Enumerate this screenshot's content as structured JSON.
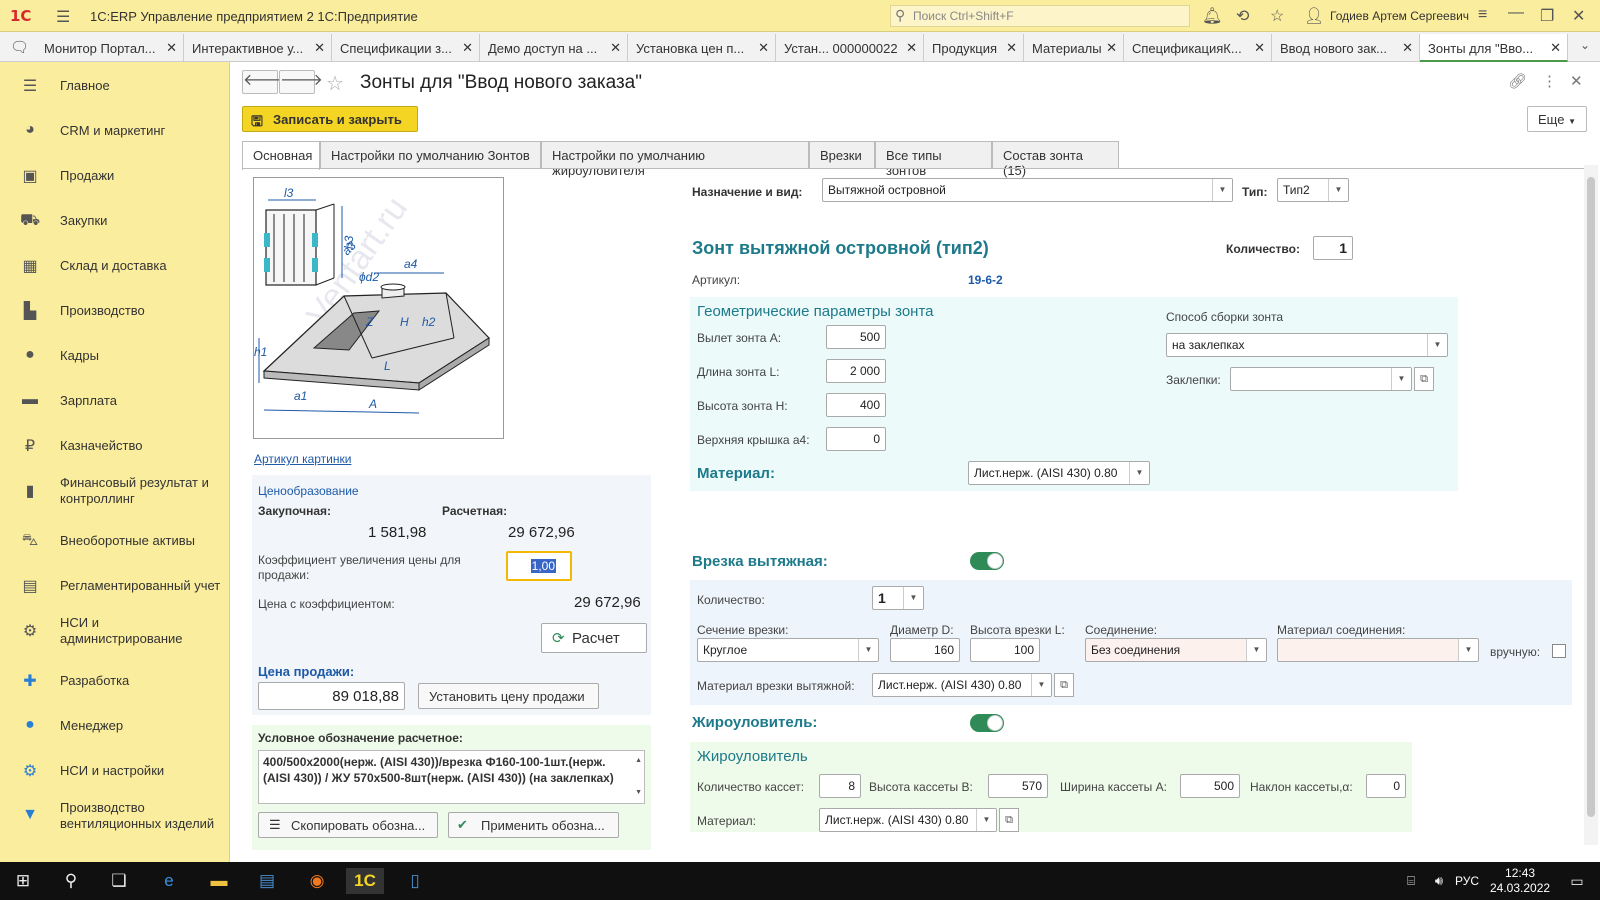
{
  "app": {
    "logo": "1С",
    "title": "1С:ERP Управление предприятием 2 1С:Предприятие",
    "search_placeholder": "Поиск Ctrl+Shift+F",
    "user": "Годиев Артем Сергеевич"
  },
  "window_tabs": [
    {
      "label": "Монитор Портал..."
    },
    {
      "label": "Интерактивное у..."
    },
    {
      "label": "Спецификации з..."
    },
    {
      "label": "Демо доступ на ..."
    },
    {
      "label": "Установка цен п..."
    },
    {
      "label": "Устан... 000000022"
    },
    {
      "label": "Продукция"
    },
    {
      "label": "Материалы"
    },
    {
      "label": "СпецификацияК..."
    },
    {
      "label": "Ввод нового зак..."
    },
    {
      "label": "Зонты для \"Вво..."
    }
  ],
  "sidebar": [
    {
      "label": "Главное",
      "icon": "menu-icon"
    },
    {
      "label": "CRM и маркетинг",
      "icon": "pie-chart-icon"
    },
    {
      "label": "Продажи",
      "icon": "bag-icon"
    },
    {
      "label": "Закупки",
      "icon": "cart-icon"
    },
    {
      "label": "Склад и доставка",
      "icon": "warehouse-icon"
    },
    {
      "label": "Производство",
      "icon": "factory-icon"
    },
    {
      "label": "Кадры",
      "icon": "person-icon"
    },
    {
      "label": "Зарплата",
      "icon": "card-icon"
    },
    {
      "label": "Казначейство",
      "icon": "ruble-icon"
    },
    {
      "label": "Финансовый результат и контроллинг",
      "icon": "bar-chart-icon"
    },
    {
      "label": "Внеоборотные активы",
      "icon": "car-icon"
    },
    {
      "label": "Регламентированный учет",
      "icon": "calculator-icon"
    },
    {
      "label": "НСИ и администрирование",
      "icon": "gear-icon"
    },
    {
      "label": "Разработка",
      "icon": "puzzle-icon"
    },
    {
      "label": "Менеджер",
      "icon": "user-icon"
    },
    {
      "label": "НСИ и настройки",
      "icon": "gears-icon"
    },
    {
      "label": "Производство вентиляционных изделий",
      "icon": "vent-icon"
    }
  ],
  "form": {
    "title": "Зонты для \"Ввод нового заказа\"",
    "save_close": "Записать и закрыть",
    "more": "Еще",
    "tabs": [
      "Основная",
      "Настройки по умолчанию Зонтов",
      "Настройки по умолчанию жироуловителя",
      "Врезки",
      "Все типы зонтов",
      "Состав зонта (15)"
    ]
  },
  "picture": {
    "article_link": "Артикул картинки",
    "watermark": "Ventart.ru",
    "dims": {
      "l3": "l3",
      "h3": "h3",
      "a3": "a3",
      "d2": "ϕd2",
      "a4": "a4",
      "z": "Z",
      "h": "H",
      "h2": "h2",
      "h1": "h1",
      "l": "L",
      "a1": "a1",
      "a": "A"
    }
  },
  "pricing": {
    "header": "Ценообразование",
    "purchase_label": "Закупочная:",
    "calc_label": "Расчетная:",
    "purchase_value": "1 581,98",
    "calc_value": "29 672,96",
    "coef_label": "Коэффициент увеличения цены для продажи:",
    "coef_value": "1,00",
    "price_coef_label": "Цена с коэффициентом:",
    "price_coef_value": "29 672,96",
    "calc_button": "Расчет",
    "sale_label": "Цена продажи:",
    "sale_value": "89 018,88",
    "set_price_button": "Установить цену продажи"
  },
  "notation": {
    "label": "Условное обозначение расчетное:",
    "text": "400/500x2000(нерж. (AISI 430))/врезка Ф160-100-1шт.(нерж. (AISI 430)) / ЖУ 570x500-8шт(нерж. (AISI 430)) (на заклепках)",
    "copy_button": "Скопировать обозна...",
    "apply_button": "Применить обозна..."
  },
  "main": {
    "purpose_label": "Назначение и вид:",
    "purpose_value": "Вытяжной островной",
    "type_label": "Тип:",
    "type_value": "Тип2",
    "product_name": "Зонт вытяжной островной (тип2)",
    "qty_label": "Количество:",
    "qty_value": "1",
    "article_label": "Артикул:",
    "article_value": "19-6-2"
  },
  "geometry": {
    "header": "Геометрические параметры зонта",
    "a_label": "Вылет зонта А:",
    "a_value": "500",
    "l_label": "Длина зонта L:",
    "l_value": "2 000",
    "h_label": "Высота зонта H:",
    "h_value": "400",
    "a4_label": "Верхняя крышка а4:",
    "a4_value": "0",
    "material_label": "Материал:",
    "material_value": "Лист.нерж. (AISI 430) 0.80",
    "assembly_label": "Способ сборки зонта",
    "assembly_value": "на заклепках",
    "rivets_label": "Заклепки:",
    "rivets_value": ""
  },
  "insert": {
    "header": "Врезка вытяжная:",
    "enabled": true,
    "qty_label": "Количество:",
    "qty_value": "1",
    "section_label": "Сечение врезки:",
    "section_value": "Круглое",
    "diam_label": "Диаметр D:",
    "diam_value": "160",
    "height_label": "Высота врезки L:",
    "height_value": "100",
    "conn_label": "Соединение:",
    "conn_value": "Без соединения",
    "conn_mat_label": "Материал соединения:",
    "conn_mat_value": "",
    "manual_label": "вручную:",
    "material_label": "Материал врезки вытяжной:",
    "material_value": "Лист.нерж. (AISI 430) 0.80"
  },
  "grease": {
    "header": "Жироуловитель:",
    "enabled": true,
    "subheader": "Жироуловитель",
    "count_label": "Количество кассет:",
    "count_value": "8",
    "height_label": "Высота кассеты B:",
    "height_value": "570",
    "width_label": "Ширина кассеты A:",
    "width_value": "500",
    "slope_label": "Наклон кассеты,α:",
    "slope_value": "0",
    "material_label": "Материал:",
    "material_value": "Лист.нерж. (AISI 430) 0.80"
  },
  "taskbar": {
    "lang": "РУС",
    "time": "12:43",
    "date": "24.03.2022"
  },
  "colors": {
    "sidebar_bg": "#fbed9e",
    "accent_yellow": "#f5d523",
    "teal_header": "#1d7a8a",
    "panel_cyan": "#ecfafa",
    "panel_blue": "#eef4fb",
    "panel_green": "#eefaea",
    "toggle_on": "#2e8b57"
  }
}
